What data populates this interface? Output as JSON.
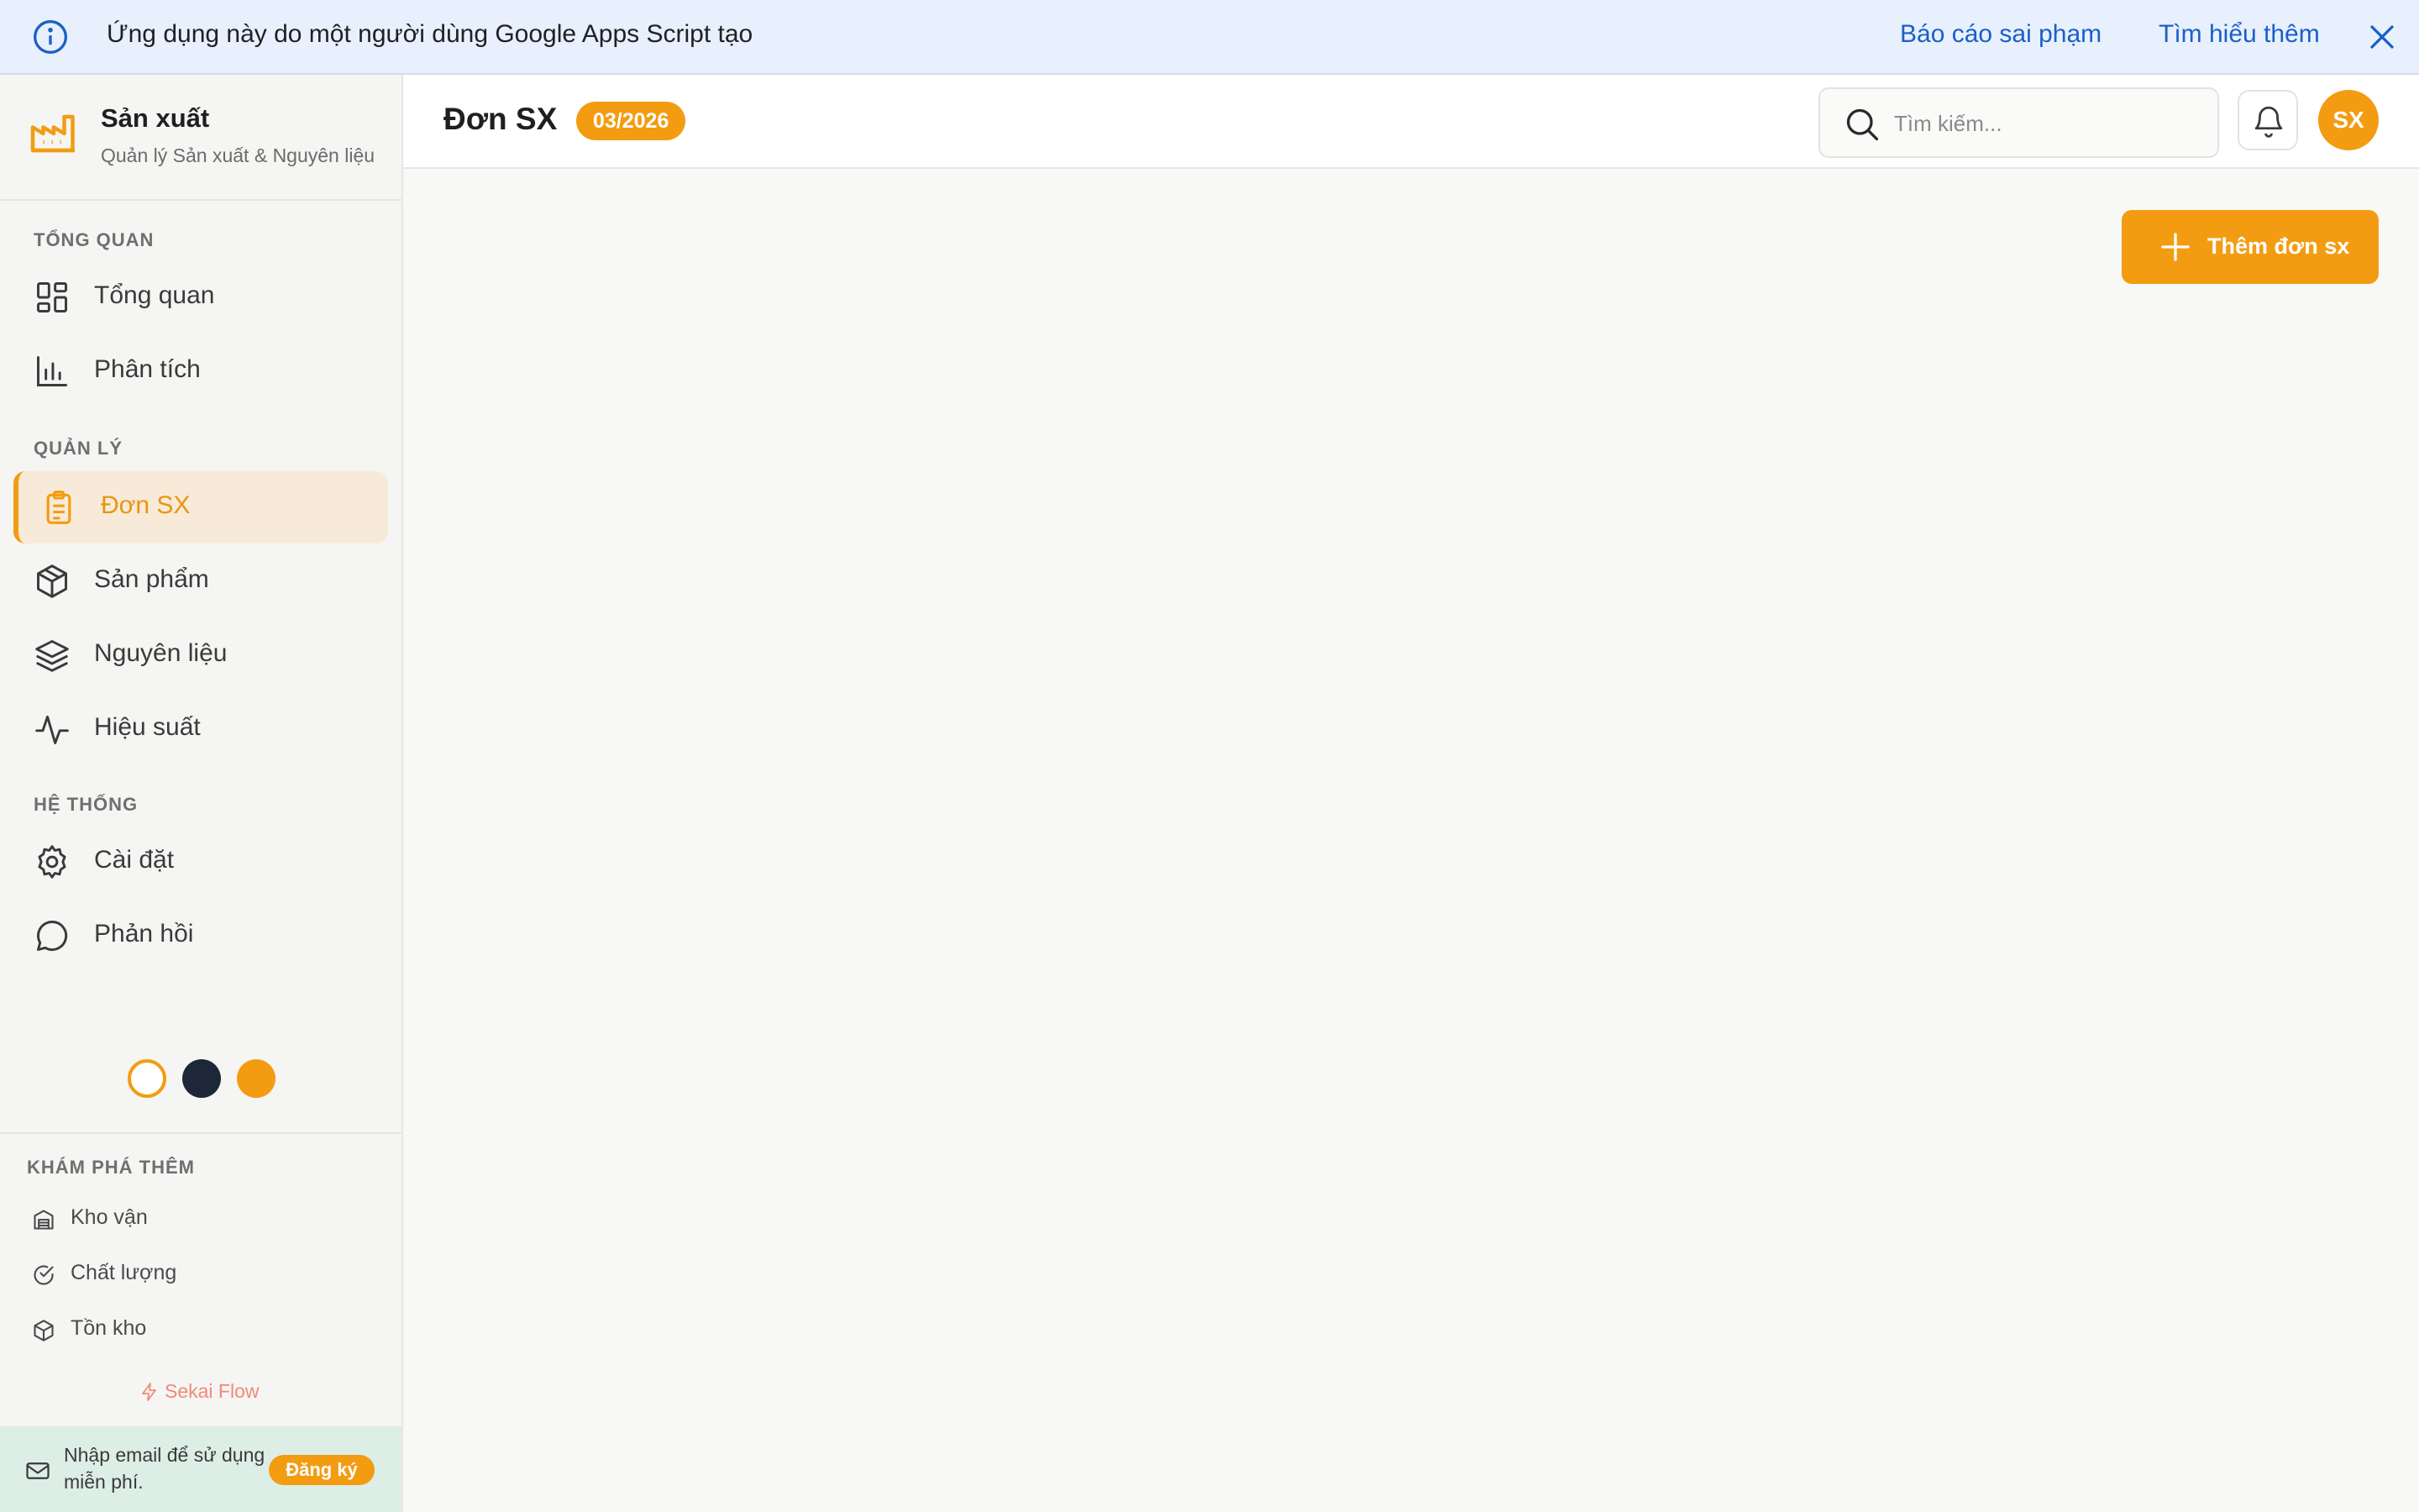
{
  "banner": {
    "message": "Ứng dụng này do một người dùng Google Apps Script tạo",
    "report_link": "Báo cáo sai phạm",
    "learn_more_link": "Tìm hiểu thêm"
  },
  "brand": {
    "name": "Sản xuất",
    "subtitle": "Quản lý Sản xuất & Nguyên liệu"
  },
  "sidebar": {
    "sections": [
      {
        "label": "TỔNG QUAN",
        "items": [
          {
            "label": "Tổng quan",
            "icon": "grid-icon"
          },
          {
            "label": "Phân tích",
            "icon": "bar-chart-icon"
          }
        ]
      },
      {
        "label": "QUẢN LÝ",
        "items": [
          {
            "label": "Đơn SX",
            "icon": "clipboard-icon",
            "active": true
          },
          {
            "label": "Sản phẩm",
            "icon": "box-icon"
          },
          {
            "label": "Nguyên liệu",
            "icon": "layers-icon"
          },
          {
            "label": "Hiệu suất",
            "icon": "activity-icon"
          }
        ]
      },
      {
        "label": "HỆ THỐNG",
        "items": [
          {
            "label": "Cài đặt",
            "icon": "gear-icon"
          },
          {
            "label": "Phản hồi",
            "icon": "chat-bubble-icon"
          }
        ]
      }
    ],
    "theme_colors": [
      "#ffffff",
      "#1e2738",
      "#f39c12"
    ],
    "explore": {
      "label": "KHÁM PHÁ THÊM",
      "items": [
        {
          "label": "Kho vận",
          "icon": "warehouse-icon"
        },
        {
          "label": "Chất lượng",
          "icon": "check-circle-icon"
        },
        {
          "label": "Tồn kho",
          "icon": "package-icon"
        }
      ]
    },
    "powered_by": "Sekai Flow",
    "signup": {
      "text": "Nhập email để sử dụng miễn phí.",
      "button": "Đăng ký"
    }
  },
  "header": {
    "title": "Đơn SX",
    "period_badge": "03/2026",
    "search_placeholder": "Tìm kiếm...",
    "avatar_initials": "SX"
  },
  "main": {
    "add_button": "Thêm đơn sx"
  },
  "colors": {
    "accent": "#f39c12",
    "active_bg": "#f8ead8",
    "banner_bg": "#e8f0fe",
    "link": "#1a5fc7"
  }
}
